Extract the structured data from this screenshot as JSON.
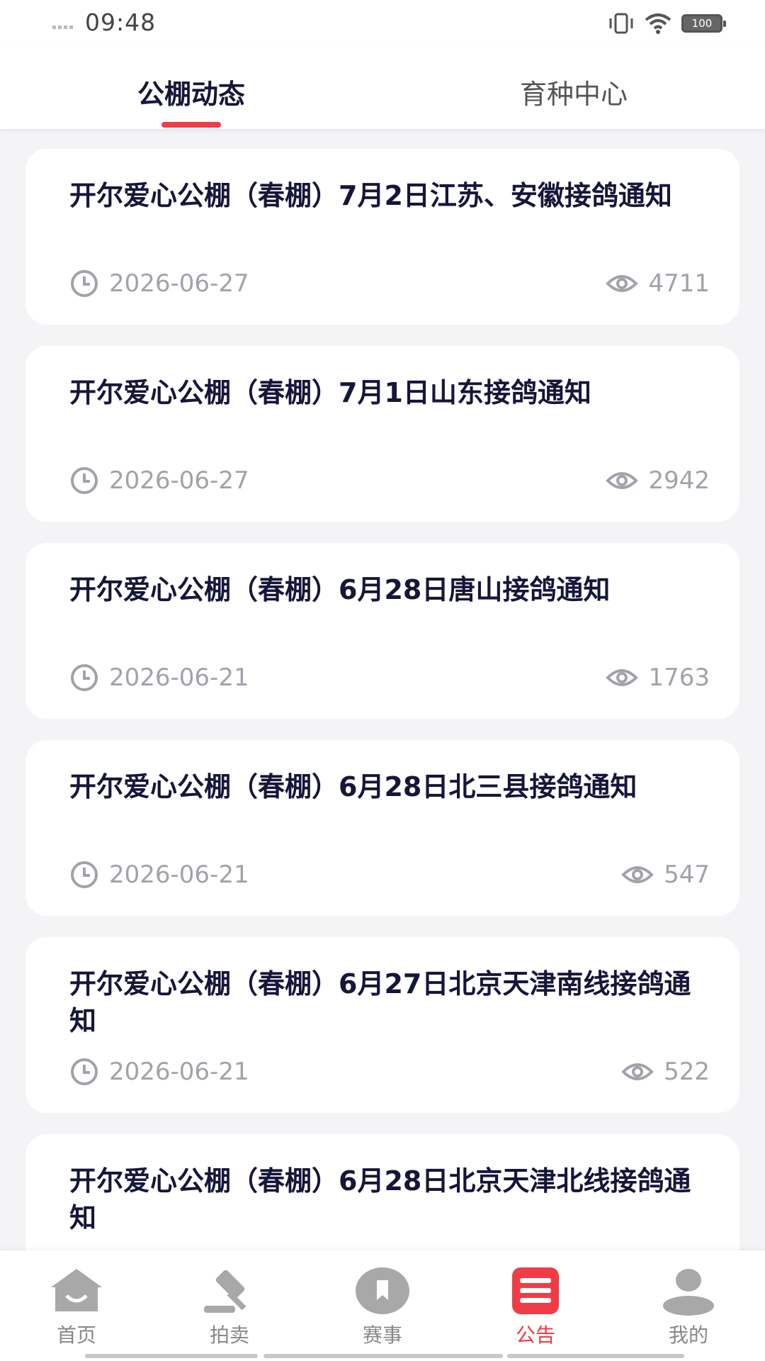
{
  "status": {
    "time": "09:48",
    "battery": "100"
  },
  "tabs": [
    {
      "label": "公棚动态"
    },
    {
      "label": "育种中心"
    }
  ],
  "items": [
    {
      "title": "开尔爱心公棚（春棚）7月2日江苏、安徽接鸽通知",
      "date": "2026-06-27",
      "views": "4711"
    },
    {
      "title": "开尔爱心公棚（春棚）7月1日山东接鸽通知",
      "date": "2026-06-27",
      "views": "2942"
    },
    {
      "title": "开尔爱心公棚（春棚）6月28日唐山接鸽通知",
      "date": "2026-06-21",
      "views": "1763"
    },
    {
      "title": "开尔爱心公棚（春棚）6月28日北三县接鸽通知",
      "date": "2026-06-21",
      "views": "547"
    },
    {
      "title": "开尔爱心公棚（春棚）6月27日北京天津南线接鸽通知",
      "date": "2026-06-21",
      "views": "522"
    },
    {
      "title": "开尔爱心公棚（春棚）6月28日北京天津北线接鸽通知",
      "date": "",
      "views": ""
    }
  ],
  "nav": [
    {
      "label": "首页",
      "icon": "home-icon"
    },
    {
      "label": "拍卖",
      "icon": "gavel-icon"
    },
    {
      "label": "赛事",
      "icon": "bookmark-icon"
    },
    {
      "label": "公告",
      "icon": "notice-icon"
    },
    {
      "label": "我的",
      "icon": "user-icon"
    }
  ],
  "colors": {
    "accent": "#f03c46",
    "title": "#16163a",
    "meta": "#a2a2aa",
    "background": "#f4f4f6"
  }
}
